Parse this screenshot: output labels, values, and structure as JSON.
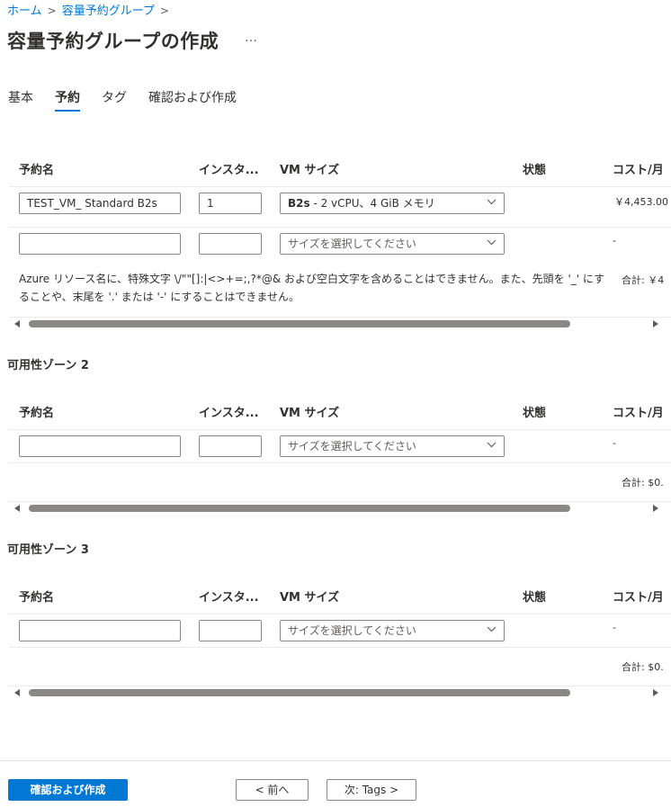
{
  "breadcrumb": {
    "home": "ホーム",
    "sep": ">",
    "group": "容量予約グループ"
  },
  "page": {
    "title": "容量予約グループの作成",
    "more": "…"
  },
  "tabs": [
    {
      "label": "基本"
    },
    {
      "label": "予約"
    },
    {
      "label": "タグ"
    },
    {
      "label": "確認および作成"
    }
  ],
  "table": {
    "headers": {
      "name": "予約名",
      "instances": "インスタ...",
      "vm_size": "VM サイズ",
      "status": "状態",
      "cost": "コスト/月"
    }
  },
  "zone1": {
    "row1": {
      "name": "TEST_VM_ Standard B2s",
      "instances": "1",
      "size_bold": "B2s",
      "size_rest": " - 2 vCPU、4 GiB メモリ",
      "cost": "￥4,453.00"
    },
    "row2": {
      "name": "",
      "instances": "",
      "size_placeholder": "サイズを選択してください",
      "cost": "-"
    },
    "error": "Azure リソース名に、特殊文字 \\/\"\"[]:|<>+=;,?*@& および空白文字を含めることはできません。また、先頭を '_' にすることや、末尾を '.' または '-' にすることはできません。",
    "total": "合計: ￥4"
  },
  "zone2": {
    "title": "可用性ゾーン 2",
    "row": {
      "name": "",
      "instances": "",
      "size_placeholder": "サイズを選択してください",
      "cost": "-"
    },
    "total": "合計: $0."
  },
  "zone3": {
    "title": "可用性ゾーン 3",
    "row": {
      "name": "",
      "instances": "",
      "size_placeholder": "サイズを選択してください",
      "cost": "-"
    },
    "total": "合計: $0."
  },
  "footer": {
    "review_create": "確認および作成",
    "prev": "< 前へ",
    "next": "次: Tags >"
  },
  "colors": {
    "accent": "#0078d4",
    "text": "#323130",
    "border": "#8a8886"
  }
}
